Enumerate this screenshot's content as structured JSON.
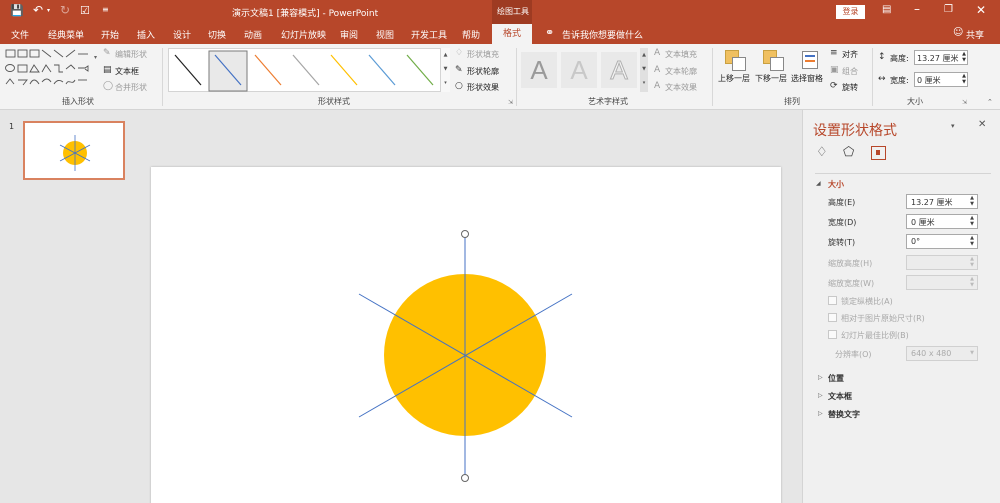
{
  "titlebar": {
    "title": "演示文稿1 [兼容模式] - PowerPoint",
    "context_tool": "绘图工具",
    "login": "登录",
    "share": "共享"
  },
  "tabs": [
    "文件",
    "经典菜单",
    "开始",
    "插入",
    "设计",
    "切换",
    "动画",
    "幻灯片放映",
    "审阅",
    "视图",
    "开发工具",
    "帮助",
    "格式"
  ],
  "search_hint": "告诉我你想要做什么",
  "ribbon": {
    "insert_shapes": {
      "label": "插入形状",
      "edit_shape": "编辑形状",
      "text_box": "文本框",
      "merge_shapes": "合并形状"
    },
    "shape_styles": {
      "label": "形状样式",
      "fill": "形状填充",
      "outline": "形状轮廓",
      "effects": "形状效果"
    },
    "wordart": {
      "label": "艺术字样式",
      "letter": "A",
      "text_fill": "文本填充",
      "text_outline": "文本轮廓",
      "text_effects": "文本效果"
    },
    "arrange": {
      "label": "排列",
      "bring_forward": "上移一层",
      "send_backward": "下移一层",
      "selection_pane": "选择窗格",
      "align": "对齐",
      "group": "组合",
      "rotate": "旋转"
    },
    "size": {
      "label": "大小",
      "height_label": "高度:",
      "height_value": "13.27 厘米",
      "width_label": "宽度:",
      "width_value": "0 厘米"
    }
  },
  "thumbnails": [
    {
      "number": "1"
    }
  ],
  "panel": {
    "title": "设置形状格式",
    "section_size": "大小",
    "height_label": "高度(E)",
    "height_value": "13.27 厘米",
    "width_label": "宽度(D)",
    "width_value": "0 厘米",
    "rotation_label": "旋转(T)",
    "rotation_value": "0°",
    "scale_h_label": "缩放高度(H)",
    "scale_w_label": "缩放宽度(W)",
    "lock_aspect": "锁定纵横比(A)",
    "relative_original": "相对于图片原始尺寸(R)",
    "best_scale": "幻灯片最佳比例(B)",
    "resolution_label": "分辨率(O)",
    "resolution_value": "640 x 480",
    "section_position": "位置",
    "section_textbox": "文本框",
    "section_alt_text": "替换文字"
  },
  "colors": {
    "accent": "#b7472a",
    "shape_fill": "#ffc000",
    "line": "#4472c4"
  }
}
